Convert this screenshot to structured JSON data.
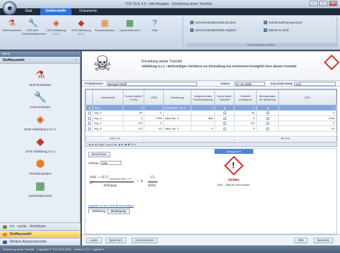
{
  "window": {
    "title": "TOX-SUS 4.0 · bild.Ausgabe · Einstufung akute Toxizität",
    "min": "—",
    "max": "□",
    "close": "✕"
  },
  "tabs": [
    "Start",
    "Gefahrstoffe",
    "Dokumente"
  ],
  "ribbon": {
    "groups": [
      {
        "label": "Gefahrstoffe",
        "buttons": [
          {
            "label": "Stoff bearbeiten",
            "icon": "flask-icon",
            "glyph": "⚗"
          },
          {
            "label": "GHS-Beh. Einstufungsrechner",
            "icon": "wrench-icon",
            "glyph": "🔧"
          },
          {
            "label": "GHS-Abbildung 3.1.1",
            "icon": "hazard-icon",
            "glyph": "◈"
          },
          {
            "label": "GHS-Abbildung 3.1.1",
            "icon": "warning-icon",
            "glyph": "◆"
          },
          {
            "label": "Periodensystem",
            "icon": "table-icon",
            "glyph": "▦"
          },
          {
            "label": "Symbolübersicht",
            "icon": "symbols-icon",
            "glyph": "▩"
          },
          {
            "label": "Hilfe",
            "icon": "help-icon",
            "glyph": "?"
          }
        ]
      }
    ],
    "quick": [
      "Sicherheitsdatenblatt drucken",
      "Sicherheitsdatenblatt englisch",
      "Gefahrstoffmanagement",
      "Etikett zu Stoff"
    ],
    "quick_group_label": "Sicherheitsdatenblätter"
  },
  "sidebar": {
    "header": "Menü",
    "section": "Stoffauswahl",
    "close": "×",
    "items": [
      {
        "label": "Stoff bearbeiten",
        "icon": "flask-icon",
        "glyph": "⚗",
        "color": "#c0392b"
      },
      {
        "label": "GHS Einheiten",
        "icon": "wrench-icon",
        "glyph": "🔧",
        "color": "#c0392b"
      },
      {
        "label": "GHS-Abbildung 2.3.1.1",
        "icon": "hazard-icon",
        "glyph": "◈",
        "color": "#d35400"
      },
      {
        "label": "GHS-Abbildung 3.1.1",
        "icon": "warning-icon",
        "glyph": "◆",
        "color": "#c0392b"
      },
      {
        "label": "Periodensystem",
        "icon": "periodic-table-icon",
        "glyph": "⬢",
        "color": "#e67e22"
      },
      {
        "label": "Symbolübersicht",
        "icon": "symbols-icon",
        "glyph": "▦",
        "color": "#2e7d32"
      }
    ],
    "bottom": [
      {
        "label": "Ich · rechts · Richtlinien",
        "color": "#6b8f3a"
      },
      {
        "label": "Stoffauswahl",
        "color": "#e08a1a",
        "selected": true
      },
      {
        "label": "Weitere Ansprechrechte",
        "color": "#3a5fa0"
      }
    ]
  },
  "document": {
    "title": "Einstufung akuter Toxizität",
    "subtitle": "Abbildung 3.1.1 - Mehrstufiges Verfahren zur Einstufung von Gemischen bezüglich ihrer akuten Toxizität",
    "form": {
      "product_label": "Produktname",
      "product_value": "Beispiel-Stoff",
      "date_label": "Datum",
      "date_value": "07.10.2009",
      "route_label": "Expositionsweg",
      "route_value": "oral"
    }
  },
  "table": {
    "headers": [
      "",
      "Inhaltsstoff",
      "Konzentration Ci (%)",
      "LD50",
      "Einstufung",
      "umgerechnete Punktschätzung",
      "keine akute Toxizität",
      "Toxizität unbekannt",
      "Bedingungen für Mischung",
      "ATEi"
    ],
    "rows": [
      {
        "name": "Ing. 1",
        "conc": "0",
        "ld50": "",
        "class": "LD50/ATE Tox. 2",
        "point": "0",
        "nontox": "",
        "unk": "0",
        "cond": "",
        "ate": "0",
        "selected": true
      },
      {
        "name": "Ing. 2",
        "conc": "40",
        "ld50": "0",
        "class": "",
        "point": "",
        "nontox": "",
        "unk": "40",
        "cond": "",
        "ate": "0"
      },
      {
        "name": "Ing. 3",
        "conc": "0",
        "ld50": "1750",
        "class": "Akut Tox. 4",
        "point": "500",
        "nontox": "",
        "unk": "0",
        "cond": "",
        "ate": "1750"
      },
      {
        "name": "Ing. 4",
        "conc": "8,9",
        "ld50": "0",
        "class": "",
        "point": "",
        "nontox": "",
        "unk": "8,9",
        "cond": "",
        "ate": "0"
      },
      {
        "name": "Ing. 5",
        "conc": "0,2",
        "ld50": "10",
        "class": "Akut Tox. 2",
        "point": "0",
        "nontox": "",
        "unk": "0",
        "cond": "",
        "ate": "10"
      }
    ],
    "sum_left": "190,1 %",
    "sum_right": "92,3 %"
  },
  "pager": "Zeile 1 von 5",
  "lower": {
    "calc_button": "Berechnen",
    "ate_label": "ATEmix",
    "ate_value": "146",
    "formula_lhs": "100 − (Σ C",
    "formula_sub": "unbekannt falls > 10 %",
    "formula_rhs": ")",
    "formula_den": "ATEmix",
    "formula_sum": "= Σ",
    "formula_ci": "Ci",
    "formula_atei": "ATEi",
    "link": "Legende zu den GHS-Berechnungen",
    "tabs": [
      "Abbildung",
      "Bedingung"
    ],
    "ghs_header": "Kategorie 3",
    "ghs_word": "Gefahr",
    "ghs_sub": "H301 - Giftig bei Verschlucken."
  },
  "actions": {
    "load": "Laden",
    "save": "Speichern",
    "reset": "Zurücksetzen",
    "help": "Hilfe",
    "close": "Beenden"
  },
  "status": "Einstufung akute Toxizität · Copyright © TOX-SUS 2009 · Version 1.0.0 · registriert"
}
